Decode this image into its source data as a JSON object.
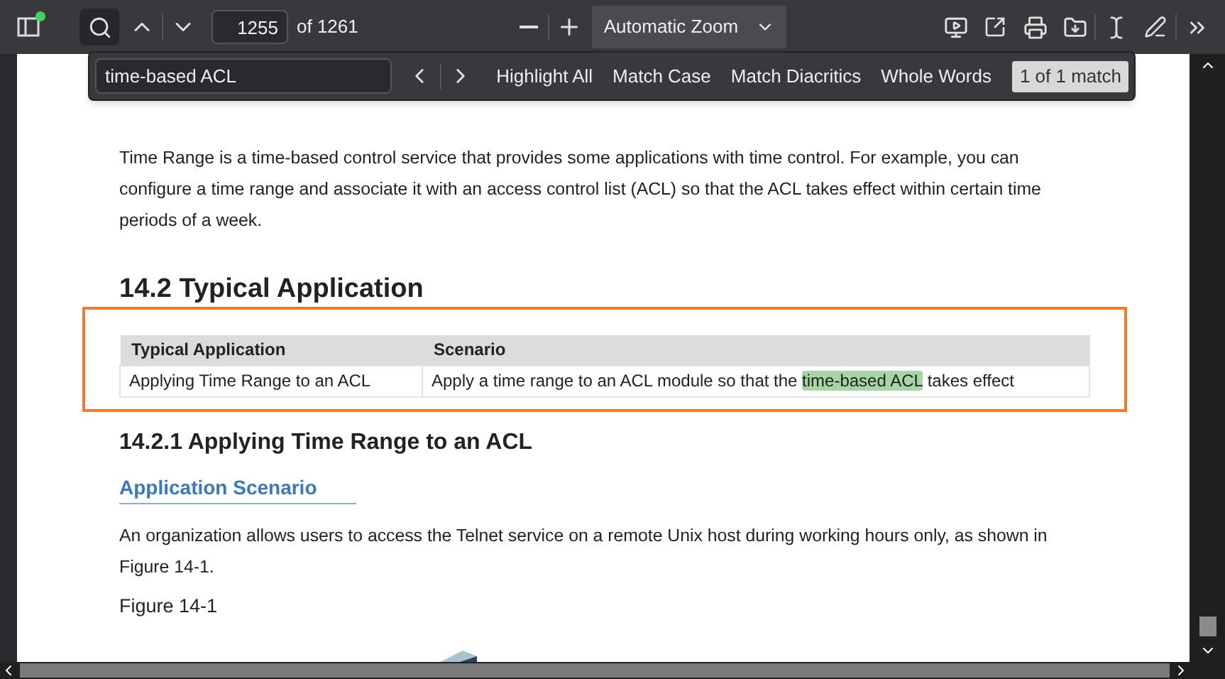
{
  "toolbar": {
    "sidebar_badge": true,
    "page_number": "1255",
    "page_count": "of 1261",
    "zoom": "Automatic Zoom",
    "search_selected": true
  },
  "find_bar": {
    "query": "time-based ACL",
    "options": [
      {
        "label": "Highlight All",
        "selected": false
      },
      {
        "label": "Match Case",
        "selected": false
      },
      {
        "label": "Match Diacritics",
        "selected": false
      },
      {
        "label": "Whole Words",
        "selected": false
      }
    ],
    "result": "1 of 1 match"
  },
  "document": [
    {
      "kind": "paragraph",
      "text": "Time Range is a time-based control service that provides some applications with time control. For example, you can configure a time range and associate it with an access control list (ACL) so that the ACL takes effect within certain time periods of a week."
    },
    {
      "kind": "heading",
      "text": "14.2 Typical Application"
    },
    {
      "kind": "table",
      "outlined": true,
      "columns": [
        "Typical Application",
        "Scenario"
      ],
      "rows": [
        [
          [
            {
              "text": "Applying Time Range to an ACL",
              "highlight": false
            }
          ],
          [
            {
              "text": "Apply a time range to an ACL module so that the ",
              "highlight": false
            },
            {
              "text": "time-based ACL",
              "highlight": true
            },
            {
              "text": " takes effect",
              "highlight": false
            }
          ]
        ]
      ]
    },
    {
      "kind": "subheading",
      "text": "14.2.1 Applying Time Range to an ACL"
    },
    {
      "kind": "section-title",
      "text": "Application Scenario"
    },
    {
      "kind": "paragraph",
      "text": "An organization allows users to access the Telnet service on a remote Unix host during working hours only, as shown in Figure 14-1."
    },
    {
      "kind": "caption",
      "text": "Figure 14-1"
    },
    {
      "kind": "figure"
    }
  ]
}
